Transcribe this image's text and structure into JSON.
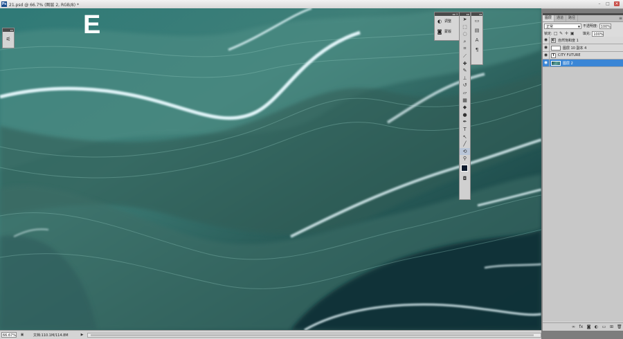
{
  "window": {
    "title": "21.psd @ 66.7% (图层 2, RGB/8) *",
    "app_icon": "Ps"
  },
  "canvas": {
    "overlay_letter": "E"
  },
  "adjustments_panel": {
    "items": [
      {
        "label": "调整",
        "icon": "adjustments-icon"
      },
      {
        "label": "蒙版",
        "icon": "mask-icon"
      }
    ]
  },
  "tools": [
    "move",
    "marquee",
    "lasso",
    "quick-select",
    "crop",
    "eyedropper",
    "healing-brush",
    "brush",
    "clone-stamp",
    "history-brush",
    "eraser",
    "gradient",
    "blur",
    "dodge",
    "pen",
    "type",
    "path-select",
    "shape",
    "3d-rotate",
    "zoom"
  ],
  "tools_active": "3d-rotate",
  "colors": {
    "foreground": "#0d1a2c",
    "background": "#ffffff",
    "selected_layer": "#3a86d6"
  },
  "layers_panel": {
    "tabs": [
      "图层",
      "通道",
      "路径"
    ],
    "blend_mode": "正常",
    "opacity_label": "不透明度:",
    "opacity_value": "100%",
    "lock_label": "锁定:",
    "fill_label": "填充:",
    "fill_value": "100%",
    "layers": [
      {
        "name": "自然饱和度 1",
        "thumb": "adjust",
        "visible": true,
        "selected": false
      },
      {
        "name": "图层 10 副本 4",
        "thumb": "blank",
        "visible": true,
        "selected": false
      },
      {
        "name": "CITY FUTURE",
        "thumb": "text",
        "visible": true,
        "selected": false
      },
      {
        "name": "图层 2",
        "thumb": "image",
        "visible": true,
        "selected": true
      }
    ]
  },
  "status_bar": {
    "zoom": "66.67%",
    "doc_info": "文档:110.1M/114.8M"
  }
}
